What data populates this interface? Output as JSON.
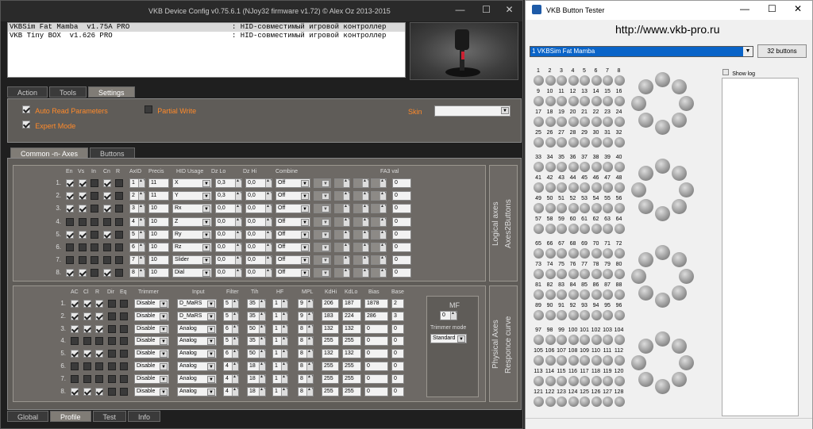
{
  "vkb": {
    "title": "VKB Device Config v0.75.6.1 (NJoy32 firmware v1.72) © Alex Oz 2013-2015",
    "devices": [
      {
        "name": "VKBSim Fat Mamba  v1.75A PRO",
        "desc": ": HID-совместимый игровой контроллер"
      },
      {
        "name": "VKB Tiny BOX  v1.626 PRO",
        "desc": ": HID-совместимый игровой контроллер"
      }
    ],
    "main_tabs": [
      "Action",
      "Tools",
      "Settings"
    ],
    "settings": {
      "auto_read": "Auto Read Parameters",
      "expert_mode": "Expert Mode",
      "partial_write": "Partial Write",
      "skin_label": "Skin"
    },
    "inner_tabs": [
      "Common -n- Axes",
      "Buttons"
    ],
    "logical": {
      "side_labels": [
        "Logical axes",
        "Axes2Buttons"
      ],
      "headers": [
        "En",
        "Vs",
        "In",
        "Cn",
        "R",
        "AxID",
        "Precis",
        "HID Usage",
        "Dz Lo",
        "Dz Hi",
        "Combine",
        "FA3 val"
      ],
      "rows": [
        {
          "n": "1.",
          "en": true,
          "vs": true,
          "in": false,
          "cn": true,
          "r": false,
          "id": "1",
          "prec": "11",
          "usage": "X",
          "dzlo": "0,3",
          "dzhi": "0,0",
          "comb": "Off",
          "fa3": "0"
        },
        {
          "n": "2.",
          "en": true,
          "vs": true,
          "in": false,
          "cn": true,
          "r": false,
          "id": "2",
          "prec": "11",
          "usage": "Y",
          "dzlo": "0,3",
          "dzhi": "0,0",
          "comb": "Off",
          "fa3": "0"
        },
        {
          "n": "3.",
          "en": true,
          "vs": true,
          "in": false,
          "cn": true,
          "r": false,
          "id": "3",
          "prec": "10",
          "usage": "Rx",
          "dzlo": "0,0",
          "dzhi": "0,0",
          "comb": "Off",
          "fa3": "0"
        },
        {
          "n": "4.",
          "en": false,
          "vs": false,
          "in": false,
          "cn": false,
          "r": false,
          "id": "4",
          "prec": "10",
          "usage": "Z",
          "dzlo": "0,0",
          "dzhi": "0,0",
          "comb": "Off",
          "fa3": "0"
        },
        {
          "n": "5.",
          "en": true,
          "vs": true,
          "in": false,
          "cn": true,
          "r": false,
          "id": "5",
          "prec": "10",
          "usage": "Ry",
          "dzlo": "0,0",
          "dzhi": "0,0",
          "comb": "Off",
          "fa3": "0"
        },
        {
          "n": "6.",
          "en": false,
          "vs": false,
          "in": false,
          "cn": false,
          "r": false,
          "id": "6",
          "prec": "10",
          "usage": "Rz",
          "dzlo": "0,0",
          "dzhi": "0,0",
          "comb": "Off",
          "fa3": "0"
        },
        {
          "n": "7.",
          "en": false,
          "vs": false,
          "in": false,
          "cn": false,
          "r": false,
          "id": "7",
          "prec": "10",
          "usage": "Slider",
          "dzlo": "0,0",
          "dzhi": "0,0",
          "comb": "Off",
          "fa3": "0"
        },
        {
          "n": "8.",
          "en": true,
          "vs": true,
          "in": false,
          "cn": true,
          "r": false,
          "id": "8",
          "prec": "10",
          "usage": "Dial",
          "dzlo": "0,0",
          "dzhi": "0,0",
          "comb": "Off",
          "fa3": "0"
        }
      ]
    },
    "physical": {
      "side_labels": [
        "Physical Axes",
        "Responce curve"
      ],
      "headers": [
        "AC",
        "Cl",
        "R",
        "Dir",
        "Eq",
        "Trimmer",
        "Input",
        "Filter",
        "Tih",
        "HF",
        "MPL",
        "KdHi",
        "KdLo",
        "Bias",
        "Base"
      ],
      "mf_label": "MF",
      "mf_value": "0",
      "trimmer_mode_label": "Trimmer mode",
      "trimmer_mode": "Standard",
      "rows": [
        {
          "n": "1.",
          "ac": true,
          "cl": true,
          "r": true,
          "dir": false,
          "eq": false,
          "trim": "Disable",
          "input": "D_MaRS",
          "filter": "5",
          "tih": "35",
          "hf": "1",
          "mpl": "9",
          "kdhi": "206",
          "kdlo": "187",
          "bias": "1878",
          "base": "2"
        },
        {
          "n": "2.",
          "ac": true,
          "cl": true,
          "r": true,
          "dir": false,
          "eq": false,
          "trim": "Disable",
          "input": "D_MaRS",
          "filter": "5",
          "tih": "35",
          "hf": "1",
          "mpl": "9",
          "kdhi": "183",
          "kdlo": "224",
          "bias": "286",
          "base": "3"
        },
        {
          "n": "3.",
          "ac": true,
          "cl": true,
          "r": true,
          "dir": false,
          "eq": false,
          "trim": "Disable",
          "input": "Analog",
          "filter": "6",
          "tih": "50",
          "hf": "1",
          "mpl": "8",
          "kdhi": "132",
          "kdlo": "132",
          "bias": "0",
          "base": "0"
        },
        {
          "n": "4.",
          "ac": false,
          "cl": false,
          "r": false,
          "dir": false,
          "eq": false,
          "trim": "Disable",
          "input": "Analog",
          "filter": "5",
          "tih": "35",
          "hf": "1",
          "mpl": "8",
          "kdhi": "255",
          "kdlo": "255",
          "bias": "0",
          "base": "0"
        },
        {
          "n": "5.",
          "ac": true,
          "cl": true,
          "r": true,
          "dir": false,
          "eq": false,
          "trim": "Disable",
          "input": "Analog",
          "filter": "6",
          "tih": "50",
          "hf": "1",
          "mpl": "8",
          "kdhi": "132",
          "kdlo": "132",
          "bias": "0",
          "base": "0"
        },
        {
          "n": "6.",
          "ac": false,
          "cl": false,
          "r": false,
          "dir": false,
          "eq": false,
          "trim": "Disable",
          "input": "Analog",
          "filter": "4",
          "tih": "18",
          "hf": "1",
          "mpl": "8",
          "kdhi": "255",
          "kdlo": "255",
          "bias": "0",
          "base": "0"
        },
        {
          "n": "7.",
          "ac": false,
          "cl": false,
          "r": false,
          "dir": false,
          "eq": false,
          "trim": "Disable",
          "input": "Analog",
          "filter": "4",
          "tih": "18",
          "hf": "1",
          "mpl": "8",
          "kdhi": "255",
          "kdlo": "255",
          "bias": "0",
          "base": "0"
        },
        {
          "n": "8.",
          "ac": true,
          "cl": true,
          "r": true,
          "dir": false,
          "eq": false,
          "trim": "Disable",
          "input": "Analog",
          "filter": "4",
          "tih": "18",
          "hf": "1",
          "mpl": "8",
          "kdhi": "255",
          "kdlo": "255",
          "bias": "0",
          "base": "0"
        }
      ]
    },
    "bottom_tabs": [
      "Global",
      "Profile",
      "Test",
      "Info"
    ]
  },
  "tester": {
    "title": "VKB Button Tester",
    "url": "http://www.vkb-pro.ru",
    "device": "1 VKBSim Fat Mamba",
    "buttons_btn": "32 buttons",
    "show_log": "Show log"
  }
}
